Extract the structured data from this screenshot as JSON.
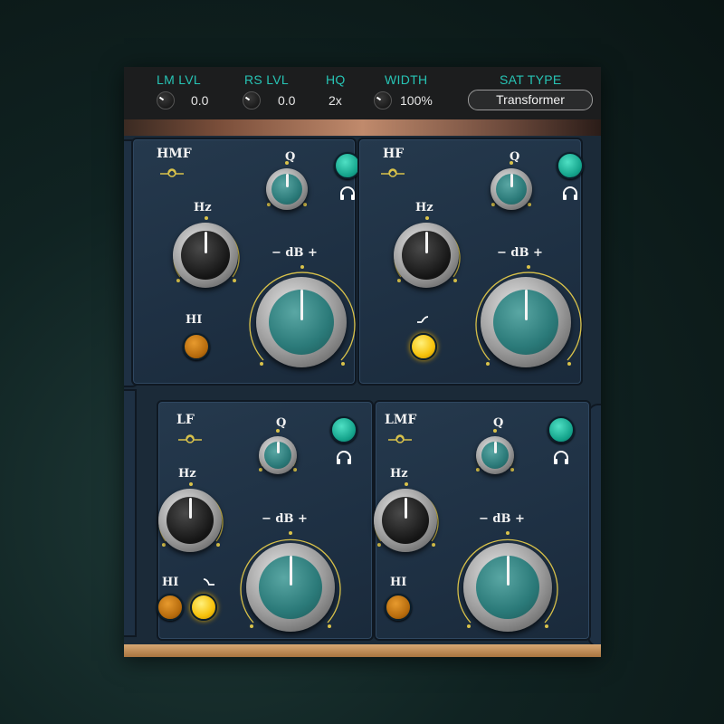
{
  "topbar": {
    "lm_lvl": {
      "label": "LM LVL",
      "value": "0.0"
    },
    "rs_lvl": {
      "label": "RS LVL",
      "value": "0.0"
    },
    "hq": {
      "label": "HQ",
      "value": "2x"
    },
    "width": {
      "label": "WIDTH",
      "value": "100%"
    },
    "sat_type": {
      "label": "SAT TYPE",
      "value": "Transformer"
    }
  },
  "bands": {
    "hmf": {
      "title": "HMF",
      "q_label": "Q",
      "hz_label": "Hz",
      "db_label": "− dB +",
      "hi_label": "HI"
    },
    "hf": {
      "title": "HF",
      "q_label": "Q",
      "hz_label": "Hz",
      "db_label": "− dB +"
    },
    "lf": {
      "title": "LF",
      "q_label": "Q",
      "hz_label": "Hz",
      "db_label": "− dB +",
      "hi_label": "HI"
    },
    "lmf": {
      "title": "LMF",
      "q_label": "Q",
      "hz_label": "Hz",
      "db_label": "− dB +",
      "hi_label": "HI"
    }
  },
  "colors": {
    "accent": "#27c4b5",
    "panel": "#1e3043",
    "gold": "#d9c24a",
    "teal_button": "#14a38b",
    "orange_button": "#b56a0c",
    "yellow_button": "#f6c20b"
  },
  "icons": [
    "knob-icon",
    "bell-curve-icon",
    "headphones-icon",
    "shelf-icon"
  ]
}
